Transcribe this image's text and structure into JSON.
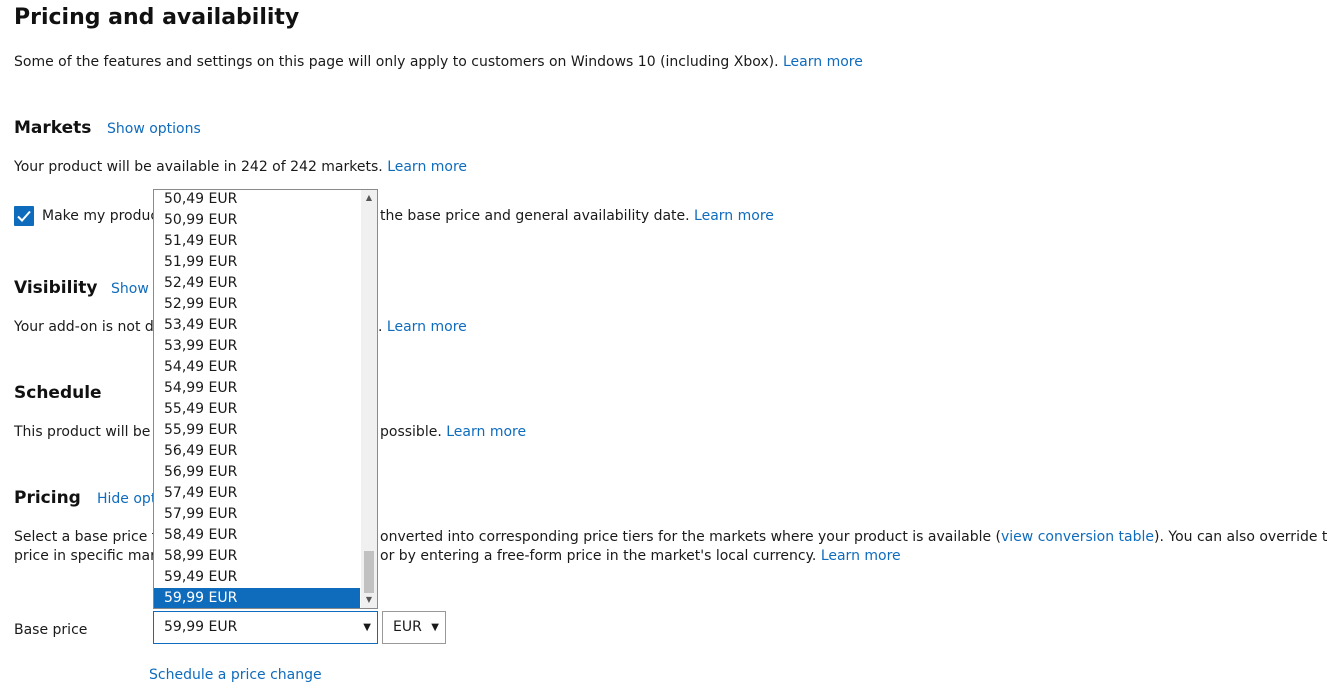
{
  "title": "Pricing and availability",
  "intro": {
    "text": "Some of the features and settings on this page will only apply to customers on Windows 10 (including Xbox).",
    "link": "Learn more"
  },
  "markets": {
    "heading": "Markets",
    "toggle": "Show options",
    "text": "Your product will be available in 242 of 242 markets.",
    "link": "Learn more",
    "checkbox_prefix": "Make my produc",
    "checkbox_suffix": "the base price and general availability date.",
    "checkbox_link": "Learn more",
    "checked": true
  },
  "visibility": {
    "heading": "Visibility",
    "toggle": "Show o",
    "text_prefix": "Your add-on is not di",
    "text_suffix": ".",
    "link": "Learn more"
  },
  "schedule": {
    "heading": "Schedule",
    "text_prefix": "This product will be a",
    "text_suffix": "possible.",
    "link": "Learn more"
  },
  "pricing": {
    "heading": "Pricing",
    "toggle": "Hide opt",
    "line1_prefix": "Select a base price fo",
    "line1_mid": "onverted into corresponding price tiers for the markets where your product is available (",
    "line1_link": "view conversion table",
    "line1_suffix": "). You can also override the base",
    "line2_prefix": "price in specific mark",
    "line2_mid": "or by entering a free-form price in the market's local currency.",
    "line2_link": "Learn more",
    "base_price_label": "Base price",
    "base_price_value": "59,99 EUR",
    "currency_value": "EUR",
    "schedule_link": "Schedule a price change"
  },
  "dropdown": {
    "options": [
      "50,49 EUR",
      "50,99 EUR",
      "51,49 EUR",
      "51,99 EUR",
      "52,49 EUR",
      "52,99 EUR",
      "53,49 EUR",
      "53,99 EUR",
      "54,49 EUR",
      "54,99 EUR",
      "55,49 EUR",
      "55,99 EUR",
      "56,49 EUR",
      "56,99 EUR",
      "57,49 EUR",
      "57,99 EUR",
      "58,49 EUR",
      "58,99 EUR",
      "59,49 EUR",
      "59,99 EUR"
    ],
    "selected": "59,99 EUR"
  },
  "icons": {
    "checkmark": "checkmark-icon",
    "dropdown_arrow": "caret-down-icon",
    "scroll_up": "scroll-up-arrow-icon",
    "scroll_down": "scroll-down-arrow-icon"
  },
  "colors": {
    "accent": "#0f6cbd",
    "text": "#1a1a1a",
    "scrollbar_thumb": "#c1c1c1"
  }
}
